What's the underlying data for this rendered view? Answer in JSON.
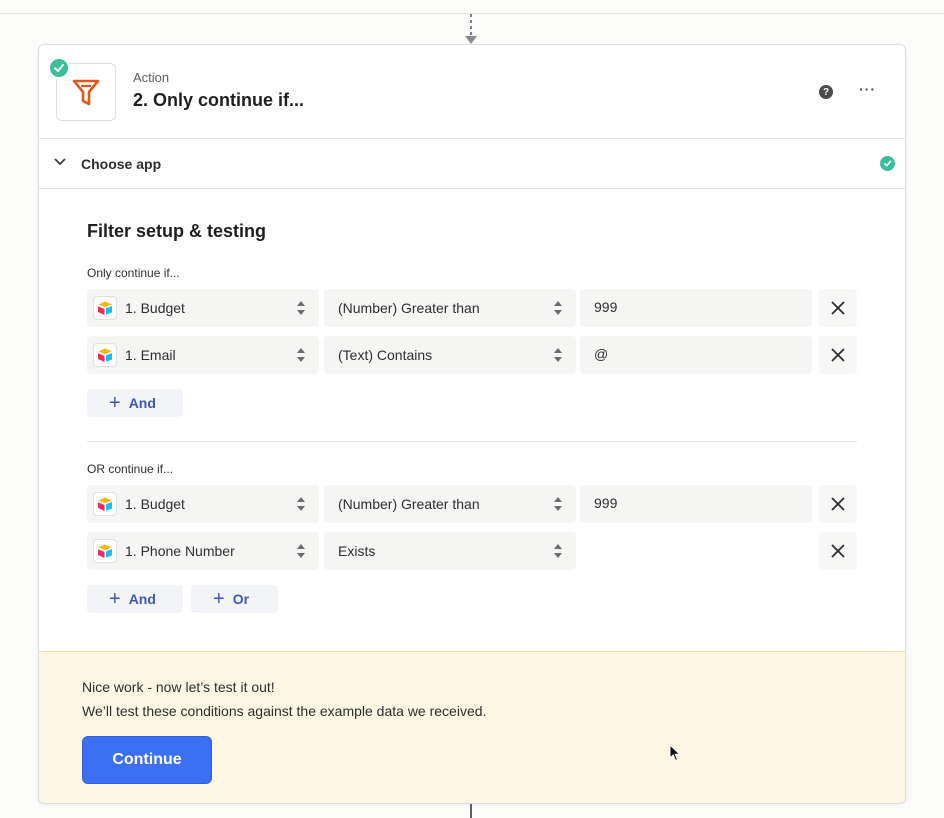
{
  "step": {
    "kind": "Action",
    "title": "2. Only continue if..."
  },
  "section": {
    "label": "Choose app"
  },
  "filter": {
    "title": "Filter setup & testing",
    "groups": [
      {
        "label": "Only continue if...",
        "conditions": [
          {
            "field": "1. Budget",
            "operator": "(Number) Greater than",
            "value": "999"
          },
          {
            "field": "1. Email",
            "operator": "(Text) Contains",
            "value": "@"
          }
        ],
        "buttons": [
          "And"
        ]
      },
      {
        "label": "OR continue if...",
        "conditions": [
          {
            "field": "1. Budget",
            "operator": "(Number) Greater than",
            "value": "999"
          },
          {
            "field": "1. Phone Number",
            "operator": "Exists",
            "value": ""
          }
        ],
        "buttons": [
          "And",
          "Or"
        ]
      }
    ]
  },
  "test": {
    "line1": "Nice work - now let’s test it out!",
    "line2": "We’ll test these conditions against the example data we received.",
    "continue_label": "Continue"
  },
  "colors": {
    "accent": "#3d6ff3",
    "success": "#3bbf9b",
    "filter_icon": "#e2571b",
    "test_panel_bg": "#fdf6e3",
    "link_blue": "#3d56b8"
  }
}
